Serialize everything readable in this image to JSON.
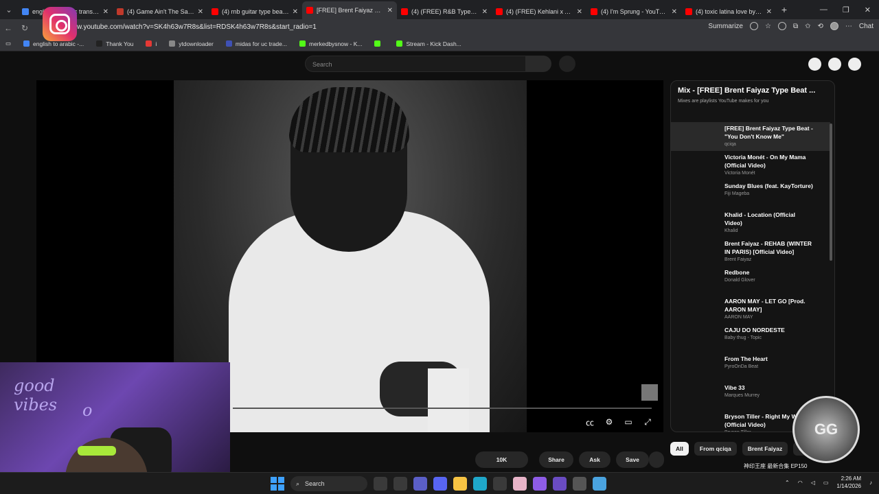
{
  "browser": {
    "tabs": [
      {
        "title": "english to arabic translation",
        "color": "#4285f4",
        "active": false
      },
      {
        "title": "(4) Game Ain't The Same by",
        "color": "#c0392b",
        "active": false
      },
      {
        "title": "(4) rnb guitar type beat - Yo",
        "color": "#ff0000",
        "active": false
      },
      {
        "title": "[FREE] Brent Faiyaz Type",
        "color": "#ff0000",
        "active": true
      },
      {
        "title": "(4) (FREE) R&B Type Beat x",
        "color": "#ff0000",
        "active": false
      },
      {
        "title": "(4) (FREE) Kehlani x Aaliyah",
        "color": "#ff0000",
        "active": false
      },
      {
        "title": "(4) I'm Sprung - YouTube",
        "color": "#ff0000",
        "active": false
      },
      {
        "title": "(4) toxic latina love by grüb",
        "color": "#ff0000",
        "active": false
      }
    ],
    "url": "w.youtube.com/watch?v=SK4h63w7R8s&list=RDSK4h63w7R8s&start_radio=1",
    "summarize_label": "Summarize",
    "chat_label": "Chat",
    "bookmarks": [
      {
        "label": "english to arabic -...",
        "color": "#4285f4"
      },
      {
        "label": "Thank You",
        "color": "#222222"
      },
      {
        "label": "i",
        "color": "#e53935"
      },
      {
        "label": "ytdownloader",
        "color": "#888888"
      },
      {
        "label": "midas for uc trade...",
        "color": "#3f51b5"
      },
      {
        "label": "merkedbysnow - K...",
        "color": "#53fc18"
      },
      {
        "label": "",
        "color": "#53fc18"
      },
      {
        "label": "Stream - Kick Dash...",
        "color": "#53fc18"
      }
    ]
  },
  "youtube": {
    "search_placeholder": "Search",
    "actions": {
      "likes": "10K",
      "share": "Share",
      "ask": "Ask",
      "save": "Save"
    },
    "playlist": {
      "title": "Mix - [FREE] Brent Faiyaz Type Beat ...",
      "subtitle": "Mixes are playlists YouTube makes for you",
      "items": [
        {
          "title": "[FREE] Brent Faiyaz Type Beat - \"You Don't Know Me\"",
          "channel": "qciqa",
          "selected": true
        },
        {
          "title": "Victoria Monét - On My Mama (Official Video)",
          "channel": "Victoria Monét",
          "selected": false
        },
        {
          "title": "Sunday Blues (feat. KayTorture)",
          "channel": "Fiji Mageba",
          "selected": false
        },
        {
          "title": "Khalid - Location (Official Video)",
          "channel": "Khalid",
          "selected": false
        },
        {
          "title": "Brent Faiyaz - REHAB (WINTER IN PARIS) [Official Video]",
          "channel": "Brent Faiyaz",
          "selected": false
        },
        {
          "title": "Redbone",
          "channel": "Donald Glover",
          "selected": false
        },
        {
          "title": "AARON MAY - LET GO [Prod. AARON MAY]",
          "channel": "AARON MAY",
          "selected": false
        },
        {
          "title": "CAJU DO NORDESTE",
          "channel": "Baby thug - Topic",
          "selected": false
        },
        {
          "title": "From The Heart",
          "channel": "PyroOnDa Beat",
          "selected": false
        },
        {
          "title": "Vibe 33",
          "channel": "Marques Murrey",
          "selected": false
        },
        {
          "title": "Bryson Tiller - Right My Wrongs (Official Video)",
          "channel": "Bryson Tiller",
          "selected": false
        }
      ]
    },
    "chips": [
      "All",
      "From qciqa",
      "Brent Faiyaz",
      "Conte"
    ],
    "marquee": "神印王座 最新合集 EP150"
  },
  "overlay": {
    "neon_text": [
      "good",
      "vibes",
      "o"
    ],
    "badge": "GG"
  },
  "taskbar": {
    "search_label": "Search",
    "time": "2:26 AM",
    "date": "1/14/2026"
  }
}
